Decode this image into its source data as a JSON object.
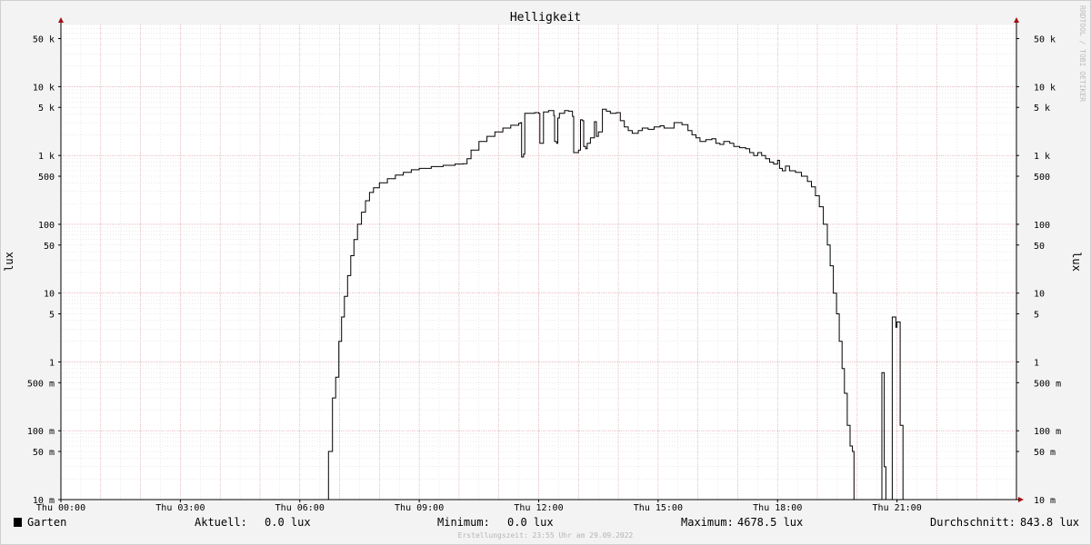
{
  "chart_data": {
    "type": "line",
    "title": "Helligkeit",
    "ylabel": "lux",
    "ylabel_right": "lux",
    "y_scale": "log",
    "ylim": [
      0.01,
      80000
    ],
    "grid": true,
    "x_ticks": [
      {
        "hour": 0,
        "label": "Thu 00:00"
      },
      {
        "hour": 3,
        "label": "Thu 03:00"
      },
      {
        "hour": 6,
        "label": "Thu 06:00"
      },
      {
        "hour": 9,
        "label": "Thu 09:00"
      },
      {
        "hour": 12,
        "label": "Thu 12:00"
      },
      {
        "hour": 15,
        "label": "Thu 15:00"
      },
      {
        "hour": 18,
        "label": "Thu 18:00"
      },
      {
        "hour": 21,
        "label": "Thu 21:00"
      }
    ],
    "y_ticks": [
      {
        "value": 50000,
        "label": "50 k"
      },
      {
        "value": 10000,
        "label": "10 k"
      },
      {
        "value": 5000,
        "label": "5 k"
      },
      {
        "value": 1000,
        "label": "1 k"
      },
      {
        "value": 500,
        "label": "500"
      },
      {
        "value": 100,
        "label": "100"
      },
      {
        "value": 50,
        "label": "50"
      },
      {
        "value": 10,
        "label": "10"
      },
      {
        "value": 5,
        "label": "5"
      },
      {
        "value": 1,
        "label": "1"
      },
      {
        "value": 0.5,
        "label": "500 m"
      },
      {
        "value": 0.1,
        "label": "100 m"
      },
      {
        "value": 0.05,
        "label": "50 m"
      },
      {
        "value": 0.01,
        "label": "10 m"
      }
    ],
    "series": [
      {
        "name": "Garten",
        "color": "#000000",
        "points": [
          [
            0,
            0.01
          ],
          [
            6.7,
            0.01
          ],
          [
            6.72,
            0.05
          ],
          [
            6.8,
            0.05
          ],
          [
            6.82,
            0.3
          ],
          [
            6.9,
            0.6
          ],
          [
            6.98,
            2
          ],
          [
            7.05,
            4.5
          ],
          [
            7.12,
            9
          ],
          [
            7.2,
            18
          ],
          [
            7.28,
            35
          ],
          [
            7.36,
            60
          ],
          [
            7.45,
            100
          ],
          [
            7.55,
            150
          ],
          [
            7.65,
            220
          ],
          [
            7.75,
            290
          ],
          [
            7.85,
            340
          ],
          [
            8.0,
            400
          ],
          [
            8.2,
            460
          ],
          [
            8.4,
            520
          ],
          [
            8.6,
            570
          ],
          [
            8.8,
            620
          ],
          [
            9.0,
            650
          ],
          [
            9.3,
            690
          ],
          [
            9.6,
            720
          ],
          [
            9.9,
            750
          ],
          [
            10.1,
            760
          ],
          [
            10.2,
            900
          ],
          [
            10.3,
            1200
          ],
          [
            10.5,
            1600
          ],
          [
            10.7,
            1900
          ],
          [
            10.9,
            2200
          ],
          [
            11.1,
            2500
          ],
          [
            11.3,
            2750
          ],
          [
            11.5,
            2950
          ],
          [
            11.55,
            3000
          ],
          [
            11.57,
            950
          ],
          [
            11.62,
            1050
          ],
          [
            11.65,
            4100
          ],
          [
            11.9,
            4200
          ],
          [
            12.0,
            4100
          ],
          [
            12.03,
            1500
          ],
          [
            12.08,
            1500
          ],
          [
            12.12,
            4300
          ],
          [
            12.25,
            4500
          ],
          [
            12.38,
            3800
          ],
          [
            12.4,
            1600
          ],
          [
            12.45,
            1500
          ],
          [
            12.48,
            3500
          ],
          [
            12.52,
            4100
          ],
          [
            12.65,
            4500
          ],
          [
            12.75,
            4400
          ],
          [
            12.85,
            3700
          ],
          [
            12.88,
            1100
          ],
          [
            12.95,
            1100
          ],
          [
            13.0,
            1200
          ],
          [
            13.05,
            3300
          ],
          [
            13.1,
            3200
          ],
          [
            13.13,
            1350
          ],
          [
            13.18,
            1250
          ],
          [
            13.22,
            1500
          ],
          [
            13.3,
            1800
          ],
          [
            13.4,
            3100
          ],
          [
            13.45,
            1900
          ],
          [
            13.5,
            2200
          ],
          [
            13.6,
            4700
          ],
          [
            13.7,
            4400
          ],
          [
            13.8,
            4100
          ],
          [
            13.95,
            4200
          ],
          [
            14.05,
            3200
          ],
          [
            14.15,
            2600
          ],
          [
            14.25,
            2300
          ],
          [
            14.35,
            2100
          ],
          [
            14.5,
            2300
          ],
          [
            14.6,
            2500
          ],
          [
            14.75,
            2400
          ],
          [
            14.9,
            2600
          ],
          [
            15.05,
            2700
          ],
          [
            15.15,
            2500
          ],
          [
            15.3,
            2500
          ],
          [
            15.4,
            3000
          ],
          [
            15.5,
            3000
          ],
          [
            15.6,
            2800
          ],
          [
            15.75,
            2300
          ],
          [
            15.85,
            2000
          ],
          [
            15.95,
            1800
          ],
          [
            16.05,
            1600
          ],
          [
            16.2,
            1700
          ],
          [
            16.35,
            1750
          ],
          [
            16.45,
            1500
          ],
          [
            16.55,
            1450
          ],
          [
            16.65,
            1600
          ],
          [
            16.8,
            1500
          ],
          [
            16.9,
            1350
          ],
          [
            17.05,
            1300
          ],
          [
            17.2,
            1250
          ],
          [
            17.3,
            1100
          ],
          [
            17.4,
            1000
          ],
          [
            17.5,
            1100
          ],
          [
            17.6,
            1000
          ],
          [
            17.7,
            900
          ],
          [
            17.8,
            800
          ],
          [
            17.9,
            750
          ],
          [
            18.0,
            850
          ],
          [
            18.05,
            650
          ],
          [
            18.12,
            600
          ],
          [
            18.2,
            700
          ],
          [
            18.3,
            600
          ],
          [
            18.45,
            570
          ],
          [
            18.6,
            500
          ],
          [
            18.75,
            420
          ],
          [
            18.85,
            350
          ],
          [
            18.95,
            260
          ],
          [
            19.05,
            180
          ],
          [
            19.15,
            100
          ],
          [
            19.25,
            50
          ],
          [
            19.32,
            25
          ],
          [
            19.4,
            10
          ],
          [
            19.48,
            5
          ],
          [
            19.55,
            2
          ],
          [
            19.62,
            0.8
          ],
          [
            19.68,
            0.35
          ],
          [
            19.75,
            0.12
          ],
          [
            19.82,
            0.06
          ],
          [
            19.88,
            0.05
          ],
          [
            19.92,
            0.01
          ],
          [
            20.6,
            0.01
          ],
          [
            20.62,
            0.7
          ],
          [
            20.65,
            0.7
          ],
          [
            20.68,
            0.03
          ],
          [
            20.72,
            0.01
          ],
          [
            20.85,
            0.01
          ],
          [
            20.88,
            4.5
          ],
          [
            20.94,
            4.5
          ],
          [
            20.97,
            3.2
          ],
          [
            21.0,
            3.8
          ],
          [
            21.06,
            3.8
          ],
          [
            21.08,
            0.12
          ],
          [
            21.12,
            0.12
          ],
          [
            21.15,
            0.01
          ],
          [
            24,
            0.01
          ]
        ]
      }
    ],
    "legend": {
      "label": "Garten",
      "color": "#000000",
      "current_label": "Aktuell:",
      "current_value": "0.0 lux",
      "min_label": "Minimum:",
      "min_value": "0.0 lux",
      "max_label": "Maximum:",
      "max_value": "4678.5 lux",
      "avg_label": "Durchschnitt:",
      "avg_value": "843.8 lux"
    },
    "footer": "Erstellungszeit: 23:55 Uhr am 29.09.2022",
    "watermark": "RRDTOOL / TOBI OETIKER"
  }
}
